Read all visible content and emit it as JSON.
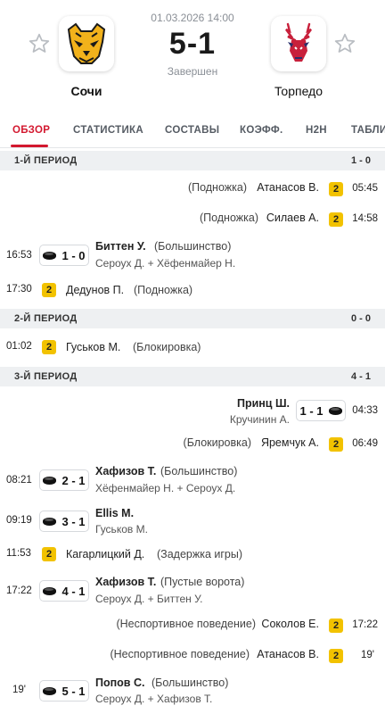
{
  "match": {
    "date": "01.03.2026 14:00",
    "score": "5-1",
    "status": "Завершен",
    "home_team": "Сочи",
    "away_team": "Торпедо"
  },
  "tabs": [
    "ОБЗОР",
    "СТАТИСТИКА",
    "СОСТАВЫ",
    "КОЭФФ.",
    "H2H",
    "ТАБЛИ"
  ],
  "periods": [
    {
      "name": "1-Й ПЕРИОД",
      "score": "1 - 0"
    },
    {
      "name": "2-Й ПЕРИОД",
      "score": "0 - 0"
    },
    {
      "name": "3-Й ПЕРИОД",
      "score": "4 - 1"
    }
  ],
  "events": {
    "e1": {
      "time": "05:45",
      "player": "Атанасов В.",
      "reason": "(Подножка)",
      "pen": "2"
    },
    "e2": {
      "time": "14:58",
      "player": "Силаев А.",
      "reason": "(Подножка)",
      "pen": "2"
    },
    "e3": {
      "time": "16:53",
      "scorer": "Биттен У.",
      "note": "(Большинство)",
      "score": "1 - 0",
      "assists": "Сероух Д. + Хёфенмайер Н."
    },
    "e4": {
      "time": "17:30",
      "player": "Дедунов П.",
      "reason": "(Подножка)",
      "pen": "2"
    },
    "e5": {
      "time": "01:02",
      "player": "Гуськов М.",
      "reason": "(Блокировка)",
      "pen": "2"
    },
    "e6": {
      "time": "04:33",
      "scorer": "Принц Ш.",
      "score": "1 - 1",
      "assists": "Кручинин А."
    },
    "e7": {
      "time": "06:49",
      "player": "Яремчук А.",
      "reason": "(Блокировка)",
      "pen": "2"
    },
    "e8": {
      "time": "08:21",
      "scorer": "Хафизов Т.",
      "note": "(Большинство)",
      "score": "2 - 1",
      "assists": "Хёфенмайер Н. + Сероух Д."
    },
    "e9": {
      "time": "09:19",
      "scorer": "Ellis M.",
      "note": "",
      "score": "3 - 1",
      "assists": "Гуськов М."
    },
    "e10": {
      "time": "11:53",
      "player": "Кагарлицкий Д.",
      "reason": "(Задержка игры)",
      "pen": "2"
    },
    "e11": {
      "time": "17:22",
      "scorer": "Хафизов Т.",
      "note": "(Пустые ворота)",
      "score": "4 - 1",
      "assists": "Сероух Д. + Биттен У."
    },
    "e12": {
      "time": "17:22",
      "player": "Соколов Е.",
      "reason": "(Неспортивное поведение)",
      "pen": "2"
    },
    "e13": {
      "time": "19'",
      "player": "Атанасов В.",
      "reason": "(Неспортивное поведение)",
      "pen": "2"
    },
    "e14": {
      "time": "19'",
      "scorer": "Попов С.",
      "note": "(Большинство)",
      "score": "5 - 1",
      "assists": "Сероух Д. + Хафизов Т."
    }
  },
  "colors": {
    "accent": "#d3182f",
    "penalty": "#f2c200",
    "period_bg": "#eef0f2"
  },
  "icons": {
    "favorite": "star-outline-icon",
    "goal": "hockey-puck-icon",
    "penalty": "penalty-card-icon"
  }
}
